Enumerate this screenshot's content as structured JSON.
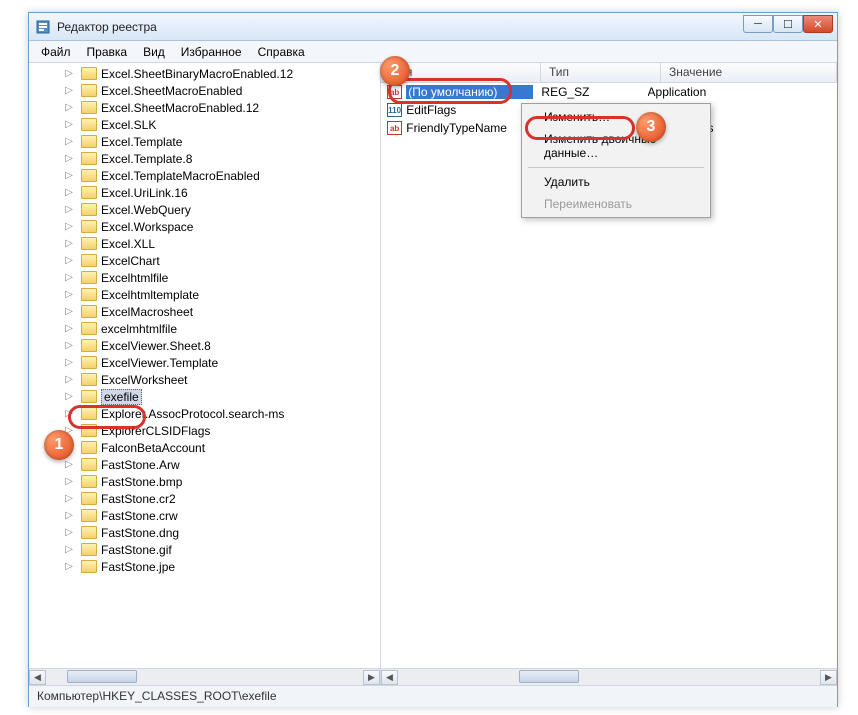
{
  "window": {
    "title": "Редактор реестра"
  },
  "menu": {
    "file": "Файл",
    "edit": "Правка",
    "view": "Вид",
    "favorites": "Избранное",
    "help": "Справка"
  },
  "tree": {
    "items": [
      "Excel.SheetBinaryMacroEnabled.12",
      "Excel.SheetMacroEnabled",
      "Excel.SheetMacroEnabled.12",
      "Excel.SLK",
      "Excel.Template",
      "Excel.Template.8",
      "Excel.TemplateMacroEnabled",
      "Excel.UriLink.16",
      "Excel.WebQuery",
      "Excel.Workspace",
      "Excel.XLL",
      "ExcelChart",
      "Excelhtmlfile",
      "Excelhtmltemplate",
      "ExcelMacrosheet",
      "excelmhtmlfile",
      "ExcelViewer.Sheet.8",
      "ExcelViewer.Template",
      "ExcelWorksheet",
      "exefile",
      "Explorer.AssocProtocol.search-ms",
      "ExplorerCLSIDFlags",
      "FalconBetaAccount",
      "FastStone.Arw",
      "FastStone.bmp",
      "FastStone.cr2",
      "FastStone.crw",
      "FastStone.dng",
      "FastStone.gif",
      "FastStone.jpe"
    ],
    "selected_index": 19
  },
  "list": {
    "columns": {
      "name": "Имя",
      "type": "Тип",
      "data": "Значение"
    },
    "rows": [
      {
        "name": "(По умолчанию)",
        "type": "REG_SZ",
        "data": "Application",
        "icon": "sz",
        "selected": true
      },
      {
        "name": "EditFlags",
        "type": "",
        "data": "",
        "icon": "bin",
        "selected": false
      },
      {
        "name": "FriendlyTypeName",
        "type": "",
        "data": "nRoot%\\Sys",
        "icon": "sz",
        "selected": false
      }
    ]
  },
  "context_menu": {
    "modify": "Изменить…",
    "modify_binary": "Изменить двоичные данные…",
    "delete": "Удалить",
    "rename": "Переименовать"
  },
  "statusbar": {
    "path": "Компьютер\\HKEY_CLASSES_ROOT\\exefile"
  },
  "markers": {
    "m1": "1",
    "m2": "2",
    "m3": "3"
  },
  "icons": {
    "ab": "ab",
    "bin": "110"
  }
}
